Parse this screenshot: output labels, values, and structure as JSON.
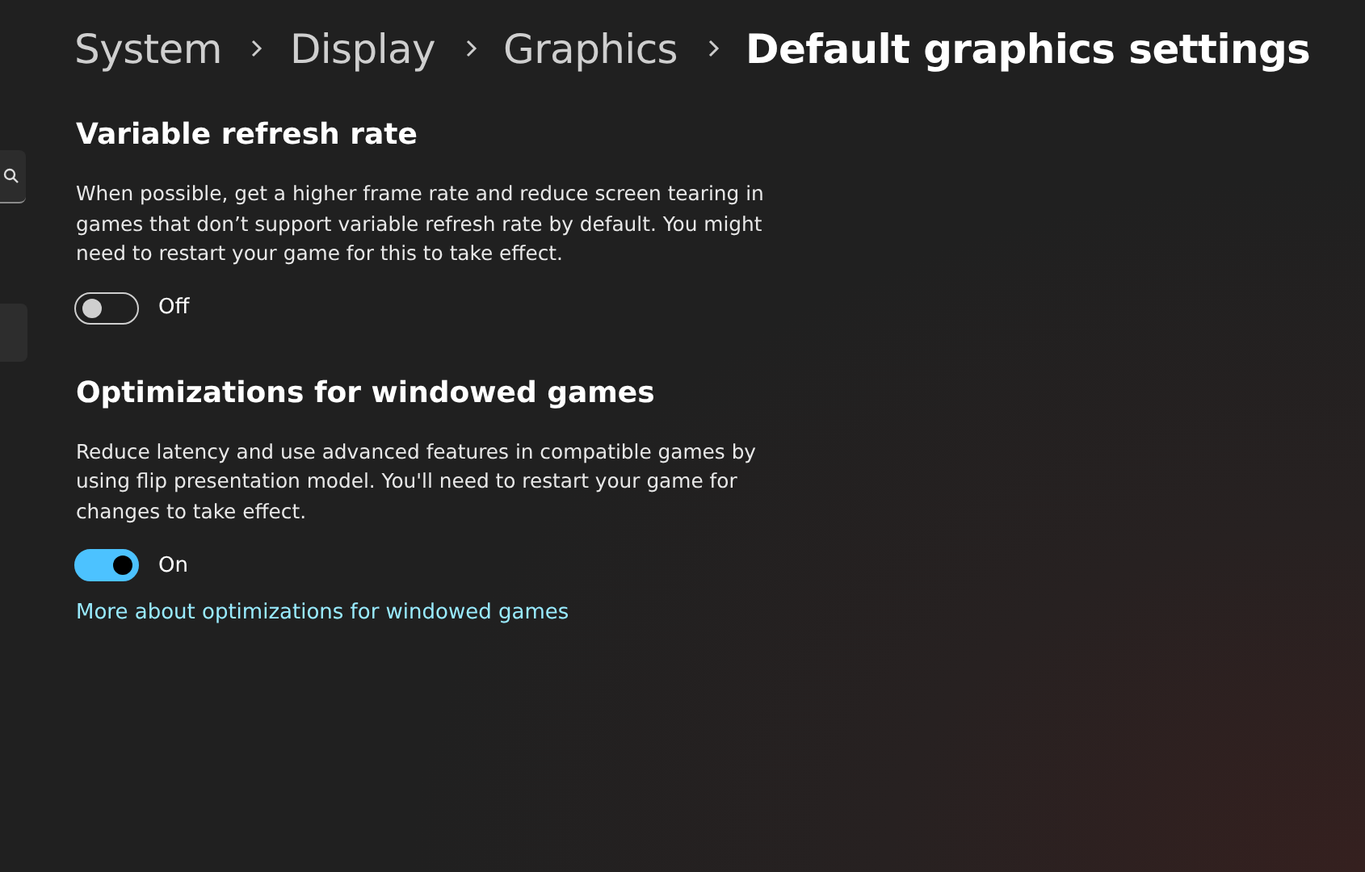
{
  "breadcrumb": [
    {
      "label": "System",
      "current": false
    },
    {
      "label": "Display",
      "current": false
    },
    {
      "label": "Graphics",
      "current": false
    },
    {
      "label": "Default graphics settings",
      "current": true
    }
  ],
  "sidebar": {
    "selected_item": true
  },
  "sections": [
    {
      "title": "Variable refresh rate",
      "description": "When possible, get a higher frame rate and reduce screen tearing in games that don’t support variable refresh rate by default. You might need to restart your game for this to take effect.",
      "toggle": {
        "on": false,
        "label": "Off"
      }
    },
    {
      "title": "Optimizations for windowed games",
      "description": "Reduce latency and use advanced features in compatible games by using flip presentation model. You'll need to restart your game for changes to take effect.",
      "toggle": {
        "on": true,
        "label": "On"
      },
      "link": "More about optimizations for windowed games"
    }
  ]
}
